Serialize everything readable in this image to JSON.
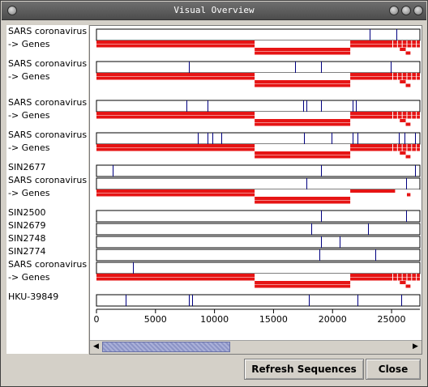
{
  "window": {
    "title": "Visual Overview"
  },
  "labels": [
    "SARS coronavirus",
    "-> Genes",
    "SARS coronavirus",
    "-> Genes",
    "SARS coronavirus",
    "-> Genes",
    "SARS coronavirus",
    "-> Genes",
    "SIN2677",
    "SARS coronavirus",
    "-> Genes",
    "SIN2500",
    "SIN2679",
    "SIN2748",
    "SIN2774",
    "SARS coronavirus",
    "-> Genes",
    "HKU-39849"
  ],
  "axis": {
    "min": 0,
    "max": 27400,
    "ticks": [
      {
        "value": 0,
        "label": "0"
      },
      {
        "value": 5000,
        "label": "5000"
      },
      {
        "value": 10000,
        "label": "10000"
      },
      {
        "value": 15000,
        "label": "15000"
      },
      {
        "value": 20000,
        "label": "20000"
      },
      {
        "value": 25000,
        "label": "25000"
      }
    ]
  },
  "gene_color": "#e61414",
  "variant_color": "#000080",
  "tracks": [
    {
      "kind": "seq",
      "variants": [
        23150,
        25400
      ]
    },
    {
      "kind": "genes"
    },
    {
      "kind": "seq",
      "variants": [
        7800,
        16800,
        19000,
        24900
      ]
    },
    {
      "kind": "genes"
    },
    {
      "kind": "seq",
      "variants": [
        7600,
        9400,
        17500,
        17800,
        19000,
        21700,
        22000
      ]
    },
    {
      "kind": "genes"
    },
    {
      "kind": "seq",
      "variants": [
        8600,
        9400,
        9800,
        10600,
        17600,
        19900,
        21700,
        22100,
        25600,
        26100,
        27000
      ]
    },
    {
      "kind": "genes"
    },
    {
      "kind": "seq",
      "variants": [
        1400,
        19000,
        27000
      ]
    },
    {
      "kind": "seq",
      "variants": [
        17800,
        26200
      ]
    },
    {
      "kind": "genes_alt"
    },
    {
      "kind": "seq",
      "variants": [
        19000,
        26200
      ]
    },
    {
      "kind": "seq",
      "variants": [
        18200,
        23000
      ]
    },
    {
      "kind": "seq",
      "variants": [
        19000,
        20600
      ]
    },
    {
      "kind": "seq",
      "variants": [
        18900,
        23600
      ]
    },
    {
      "kind": "seq",
      "variants": [
        3100
      ]
    },
    {
      "kind": "genes"
    },
    {
      "kind": "seq",
      "variants": [
        2500,
        7800,
        8100,
        18000,
        22100,
        25800
      ]
    }
  ],
  "buttons": {
    "refresh": "Refresh Sequences",
    "close": "Close"
  },
  "icons": {
    "title_left": "window-menu-icon",
    "title_right": [
      "minimize-icon",
      "maximize-icon",
      "close-icon"
    ],
    "scroll_left": "arrow-left-icon",
    "scroll_right": "arrow-right-icon"
  }
}
